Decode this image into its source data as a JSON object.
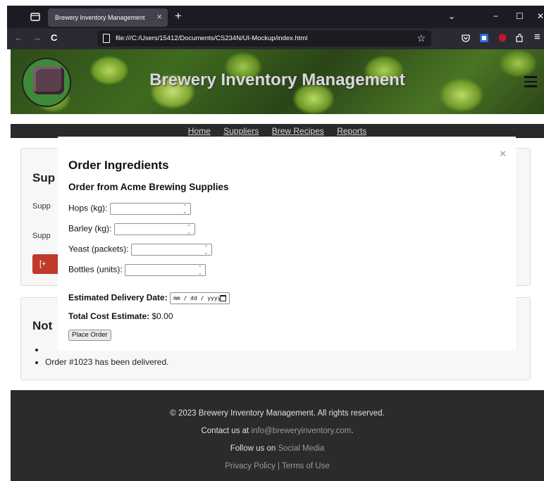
{
  "browser": {
    "tab_title": "Brewery Inventory Management",
    "tab_close": "×",
    "new_tab": "+",
    "url": "file:///C:/Users/15412/Documents/CS234N/UI-Mockup/index.html",
    "back": "←",
    "forward": "→",
    "reload": "C",
    "bookmark_star": "☆",
    "minimize": "−",
    "maximize": "☐",
    "close": "✕",
    "menu": "≡",
    "tabs_dropdown": "⌄"
  },
  "header": {
    "title": "Brewery Inventory Management"
  },
  "nav": {
    "items": [
      "Home",
      "Suppliers",
      "Brew Recipes",
      "Reports"
    ]
  },
  "suppliers_section": {
    "heading": "Sup",
    "row1": "Supp",
    "row2": "Supp",
    "add_button": "[+"
  },
  "notes_section": {
    "heading": "Not",
    "items": [
      "",
      "Order #1023 has been delivered."
    ]
  },
  "footer": {
    "copyright": "© 2023 Brewery Inventory Management. All rights reserved.",
    "contact_prefix": "Contact us at ",
    "contact_email": "info@breweryinventory.com",
    "contact_suffix": ".",
    "follow_prefix": "Follow us on ",
    "follow_link": "Social Media",
    "privacy": "Privacy Policy",
    "separator": " | ",
    "terms": "Terms of Use"
  },
  "modal": {
    "close": "×",
    "title": "Order Ingredients",
    "subtitle": "Order from Acme Brewing Supplies",
    "fields": [
      {
        "label": "Hops (kg):",
        "value": ""
      },
      {
        "label": "Barley (kg):",
        "value": ""
      },
      {
        "label": "Yeast (packets):",
        "value": ""
      },
      {
        "label": "Bottles (units):",
        "value": ""
      }
    ],
    "delivery_label": "Estimated Delivery Date:",
    "delivery_placeholder": "mm / dd / yyyy",
    "cost_label": "Total Cost Estimate:",
    "cost_value": " $0.00",
    "place_order": "Place Order"
  }
}
